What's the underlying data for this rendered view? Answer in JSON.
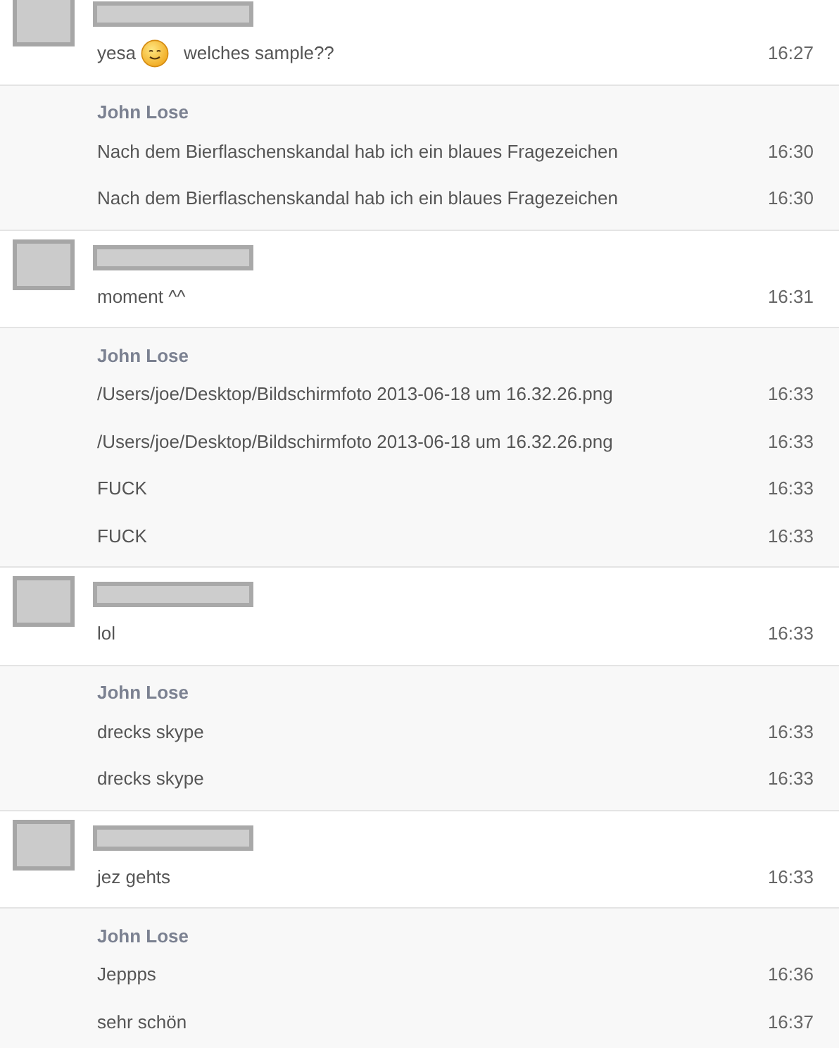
{
  "groups": [
    {
      "kind": "other",
      "messages": [
        {
          "text": "yesa",
          "emoji": true,
          "text_after": "welches sample??",
          "time": "16:27"
        }
      ]
    },
    {
      "kind": "self",
      "name": "John Lose",
      "messages": [
        {
          "text": "Nach dem Bierflaschenskandal hab ich ein blaues Fragezeichen",
          "time": "16:30"
        },
        {
          "text": "Nach dem Bierflaschenskandal hab ich ein blaues Fragezeichen",
          "time": "16:30"
        }
      ]
    },
    {
      "kind": "other",
      "messages": [
        {
          "text": "moment ^^",
          "time": "16:31"
        }
      ]
    },
    {
      "kind": "self",
      "name": "John Lose",
      "messages": [
        {
          "text": "/Users/joe/Desktop/Bildschirmfoto 2013-06-18 um 16.32.26.png",
          "time": "16:33"
        },
        {
          "text": "/Users/joe/Desktop/Bildschirmfoto 2013-06-18 um 16.32.26.png",
          "time": "16:33"
        },
        {
          "text": "FUCK",
          "time": "16:33"
        },
        {
          "text": "FUCK",
          "time": "16:33"
        }
      ]
    },
    {
      "kind": "other",
      "messages": [
        {
          "text": "lol",
          "time": "16:33"
        }
      ]
    },
    {
      "kind": "self",
      "name": "John Lose",
      "messages": [
        {
          "text": "drecks skype",
          "time": "16:33"
        },
        {
          "text": "drecks skype",
          "time": "16:33"
        }
      ]
    },
    {
      "kind": "other",
      "messages": [
        {
          "text": "jez gehts",
          "time": "16:33"
        }
      ]
    },
    {
      "kind": "self",
      "name": "John Lose",
      "messages": [
        {
          "text": "Jeppps",
          "time": "16:36"
        },
        {
          "text": "sehr schön",
          "time": "16:37"
        }
      ]
    }
  ]
}
